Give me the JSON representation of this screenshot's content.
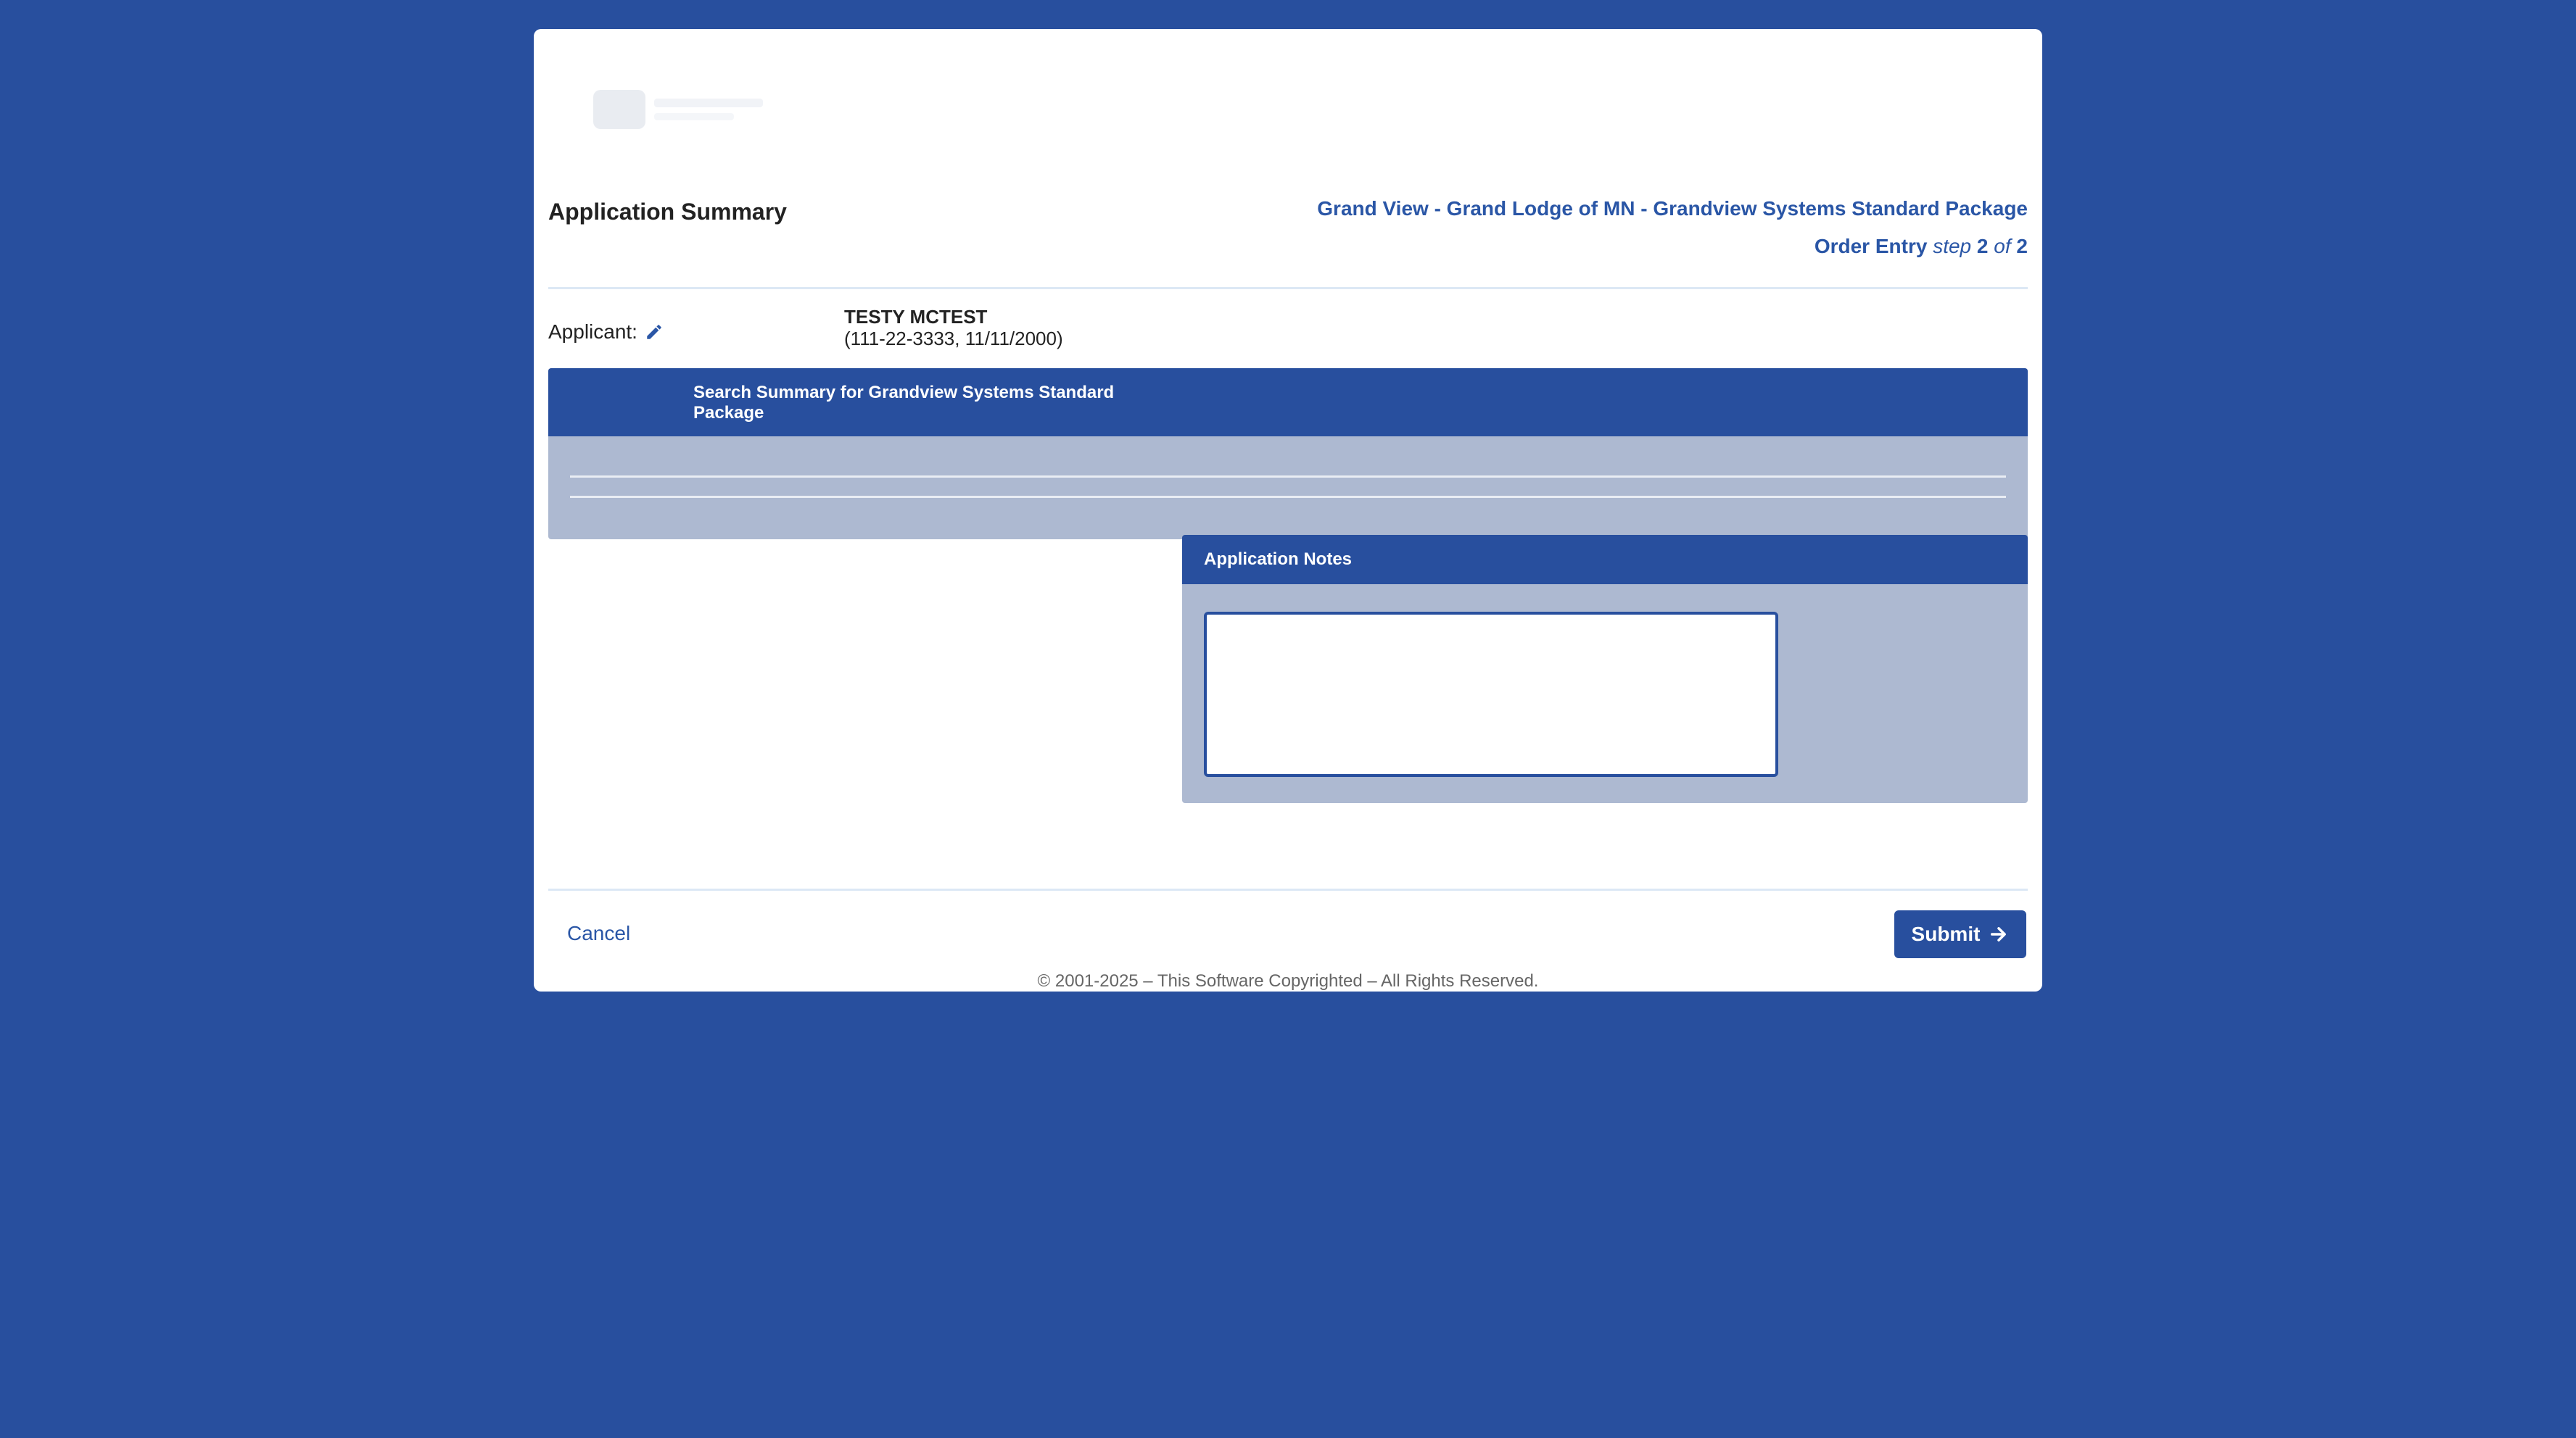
{
  "header": {
    "page_title": "Application Summary",
    "breadcrumb": "Grand View - Grand Lodge of MN - Grandview Systems Standard Package",
    "step_label": "Order Entry",
    "step_word": "step",
    "step_current": "2",
    "step_of": "of",
    "step_total": "2"
  },
  "applicant": {
    "label": "Applicant:",
    "name": "TESTY MCTEST",
    "details": "(111-22-3333, 11/11/2000)",
    "edit_icon": "pencil-icon"
  },
  "search_summary": {
    "title": "Search Summary for Grandview Systems Standard Package"
  },
  "notes": {
    "title": "Application Notes",
    "value": ""
  },
  "footer": {
    "cancel_label": "Cancel",
    "submit_label": "Submit",
    "submit_icon": "arrow-right-icon",
    "copyright": "© 2001-2025 – This Software Copyrighted – All Rights Reserved."
  },
  "colors": {
    "brand_blue": "#284f9e",
    "panel_gray": "#adb9d1",
    "link_blue": "#2a56a6"
  }
}
